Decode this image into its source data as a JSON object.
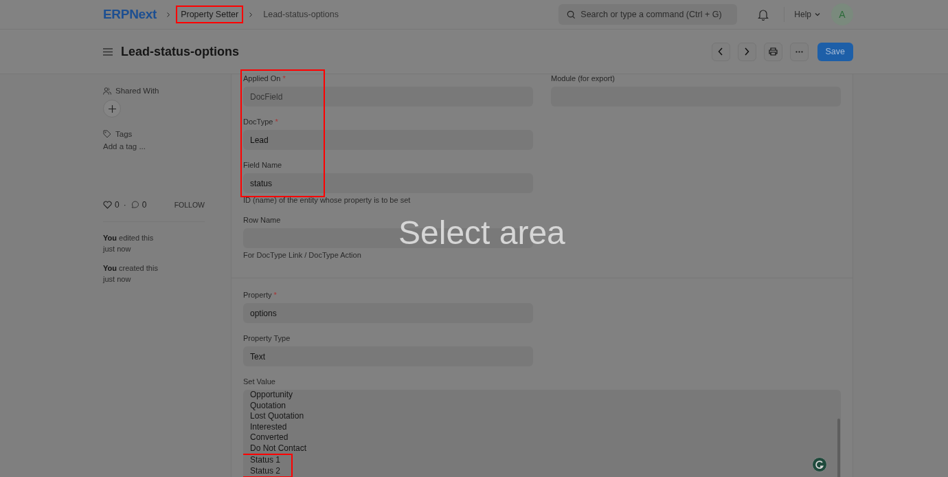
{
  "navbar": {
    "logo": "ERPNext",
    "breadcrumbs": [
      {
        "label": "Property Setter",
        "highlighted": true
      },
      {
        "label": "Lead-status-options",
        "highlighted": false
      }
    ],
    "search": {
      "placeholder": "Search or type a command (Ctrl + G)"
    },
    "help": "Help",
    "avatar": "A"
  },
  "page": {
    "title": "Lead-status-options",
    "save": "Save"
  },
  "sidebar": {
    "shared_with": "Shared With",
    "tags": "Tags",
    "add_tag": "Add a tag ...",
    "likes": "0",
    "separator": "·",
    "comments": "0",
    "follow": "FOLLOW",
    "activity": [
      {
        "actor": "You",
        "text": "edited this",
        "time": "just now"
      },
      {
        "actor": "You",
        "text": "created this",
        "time": "just now"
      }
    ]
  },
  "form": {
    "required_mark": "*",
    "sections": [
      {
        "columns": [
          [
            {
              "kind": "select",
              "label": "Applied On",
              "required": true,
              "value": "DocField",
              "highlighted": true
            },
            {
              "kind": "input",
              "label": "DocType",
              "required": true,
              "value": "Lead",
              "highlighted": true
            },
            {
              "kind": "input",
              "label": "Field Name",
              "required": false,
              "value": "status",
              "description": "ID (name) of the entity whose property is to be set",
              "highlighted": true
            },
            {
              "kind": "input",
              "label": "Row Name",
              "required": false,
              "description": "For DocType Link / DocType Action",
              "highlighted": false
            }
          ],
          [
            {
              "kind": "input",
              "label": "Module (for export)",
              "required": false,
              "highlighted": false
            }
          ]
        ]
      },
      {
        "columns": [
          [
            {
              "kind": "input",
              "label": "Property",
              "required": true,
              "value": "options",
              "highlighted": false
            },
            {
              "kind": "input",
              "label": "Property Type",
              "required": false,
              "value": "Text",
              "highlighted": false
            },
            {
              "kind": "textarea",
              "label": "Set Value",
              "required": false,
              "highlighted": false,
              "lines": [
                {
                  "text": "Opportunity",
                  "highlighted": false
                },
                {
                  "text": "Quotation",
                  "highlighted": false
                },
                {
                  "text": "Lost Quotation",
                  "highlighted": false
                },
                {
                  "text": "Interested",
                  "highlighted": false
                },
                {
                  "text": "Converted",
                  "highlighted": false
                },
                {
                  "text": "Do Not Contact",
                  "highlighted": false
                },
                {
                  "text": "Status 1",
                  "highlighted": true
                },
                {
                  "text": "Status 2",
                  "highlighted": true
                }
              ]
            }
          ]
        ]
      }
    ]
  },
  "overlay": {
    "hint": "Select area"
  }
}
